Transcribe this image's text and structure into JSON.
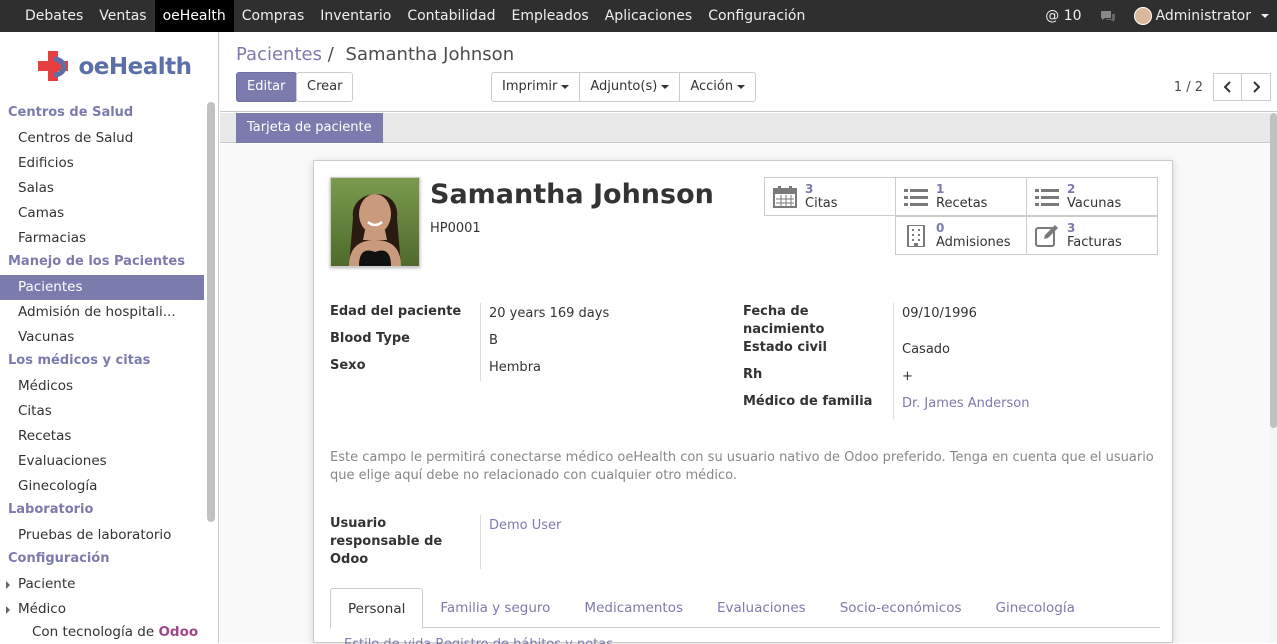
{
  "topbar": {
    "menu": [
      "Debates",
      "Ventas",
      "oeHealth",
      "Compras",
      "Inventario",
      "Contabilidad",
      "Empleados",
      "Aplicaciones",
      "Configuración"
    ],
    "active_menu": "oeHealth",
    "notifications": "@ 10",
    "user": "Administrator"
  },
  "sidebar": {
    "brand": "oeHealth",
    "sections": [
      {
        "title": "Centros de Salud",
        "items": [
          "Centros de Salud",
          "Edificios",
          "Salas",
          "Camas",
          "Farmacias"
        ]
      },
      {
        "title": "Manejo de los Pacientes",
        "items": [
          "Pacientes",
          "Admisión de hospitali...",
          "Vacunas"
        ]
      },
      {
        "title": "Los médicos y citas",
        "items": [
          "Médicos",
          "Citas",
          "Recetas",
          "Evaluaciones",
          "Ginecología"
        ]
      },
      {
        "title": "Laboratorio",
        "items": [
          "Pruebas de laboratorio"
        ]
      },
      {
        "title": "Configuración",
        "items": [
          "Paciente",
          "Médico"
        ]
      }
    ],
    "active_item": "Pacientes",
    "footer_prefix": "Con tecnología de",
    "footer_brand": "Odoo"
  },
  "header": {
    "breadcrumb_link": "Pacientes",
    "breadcrumb_sep": "/",
    "breadcrumb_current": "Samantha Johnson",
    "edit_label": "Editar",
    "create_label": "Crear",
    "print_label": "Imprimir",
    "attach_label": "Adjunto(s)",
    "action_label": "Acción",
    "pager": "1 / 2"
  },
  "statusbar": {
    "card_button": "Tarjeta de paciente"
  },
  "patient": {
    "name": "Samantha Johnson",
    "id": "HP0001"
  },
  "smart_buttons": [
    {
      "count": "3",
      "label": "Citas",
      "icon": "calendar-icon"
    },
    {
      "count": "1",
      "label": "Recetas",
      "icon": "list-icon"
    },
    {
      "count": "2",
      "label": "Vacunas",
      "icon": "list-icon"
    },
    {
      "count": "0",
      "label": "Admisiones",
      "icon": "building-icon"
    },
    {
      "count": "3",
      "label": "Facturas",
      "icon": "edit-icon"
    }
  ],
  "fields_left": [
    {
      "label": "Edad del paciente",
      "value": "20 years 169 days"
    },
    {
      "label": "Blood Type",
      "value": "B"
    },
    {
      "label": "Sexo",
      "value": "Hembra"
    }
  ],
  "fields_right": [
    {
      "label": "Fecha de nacimiento",
      "value": "09/10/1996"
    },
    {
      "label": "Estado civil",
      "value": "Casado"
    },
    {
      "label": "Rh",
      "value": "+"
    },
    {
      "label": "Médico de familia",
      "value": "Dr. James Anderson"
    }
  ],
  "note": "Este campo le permitirá conectarse médico oeHealth con su usuario nativo de Odoo preferido. Tenga en cuenta que el usuario que elige aquí debe no relacionado con cualquier otro médico.",
  "odoo_user": {
    "label": "Usuario responsable de Odoo",
    "value": "Demo User"
  },
  "tabs": [
    "Personal",
    "Familia y seguro",
    "Medicamentos",
    "Evaluaciones",
    "Socio-económicos",
    "Ginecología"
  ],
  "active_tab": "Personal",
  "tabs_row2": "Estilo de vida     Registro de hábitos y notas",
  "colors": {
    "accent": "#7c7bad",
    "topbar": "#2f2f2f",
    "brand_red": "#e53f3f",
    "brand_blue": "#5b6fa8"
  }
}
